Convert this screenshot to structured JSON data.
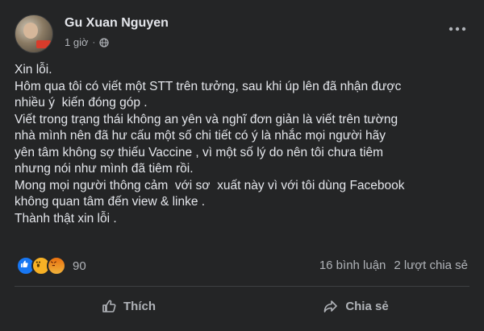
{
  "post": {
    "author": "Gu Xuan Nguyen",
    "time": "1 giờ",
    "separator": "·",
    "content_lines": [
      "Xin lỗi.",
      "Hôm qua tôi có viết một STT trên tưởng, sau khi úp lên đã nhận được",
      "nhiều ý  kiến đóng góp .",
      "Viết trong trạng thái không an yên và nghĩ đơn giản là viết trên tường",
      "nhà mình nên đã hư cấu một số chi tiết có ý là nhắc mọi người hãy",
      "yên tâm không sợ thiếu Vaccine , vì một số lý do nên tôi chưa tiêm",
      "nhưng nói như mình đã tiêm rồi.",
      "Mong mọi người thông cảm  với sơ  xuất này vì với tôi dùng Facebook",
      "không quan tâm đến view & linke .",
      "Thành thật xin lỗi ."
    ],
    "more_icon": "more-horizontal-icon"
  },
  "reactions": {
    "count": "90",
    "icons": [
      "like-icon",
      "wow-icon",
      "angry-icon"
    ]
  },
  "stats": {
    "comments": "16 bình luận",
    "shares": "2 lượt chia sẻ"
  },
  "actions": {
    "like_label": "Thích",
    "share_label": "Chia sẻ"
  },
  "colors": {
    "background": "#242526",
    "text": "#e4e6eb",
    "secondary_text": "#b0b3b8",
    "like_blue": "#1877f2"
  }
}
